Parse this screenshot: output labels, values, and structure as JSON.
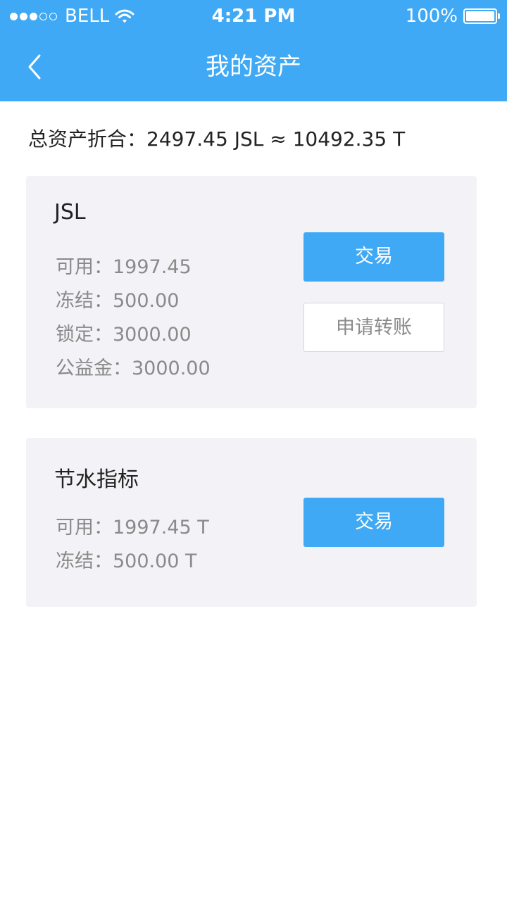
{
  "status_bar": {
    "carrier": "BELL",
    "time": "4:21 PM",
    "battery": "100%",
    "signal_strength": 3,
    "signal_total": 5,
    "battery_level": 1.0
  },
  "nav": {
    "title": "我的资产",
    "back_icon": "chevron-left-icon"
  },
  "summary": {
    "total_text": "总资产折合：2497.45 JSL ≈ 10492.35 T"
  },
  "assets": [
    {
      "title": "JSL",
      "rows": [
        "可用：1997.45",
        "冻结：500.00",
        "锁定：3000.00",
        "公益金：3000.00"
      ],
      "trade_label": "交易",
      "transfer_label": "申请转账"
    },
    {
      "title": "节水指标",
      "rows": [
        "可用：1997.45 T",
        "冻结：500.00 T"
      ],
      "trade_label": "交易"
    }
  ],
  "colors": {
    "accent": "#3fa9f5",
    "card_bg": "#f3f3f7",
    "muted_text": "#8a8a8a"
  }
}
